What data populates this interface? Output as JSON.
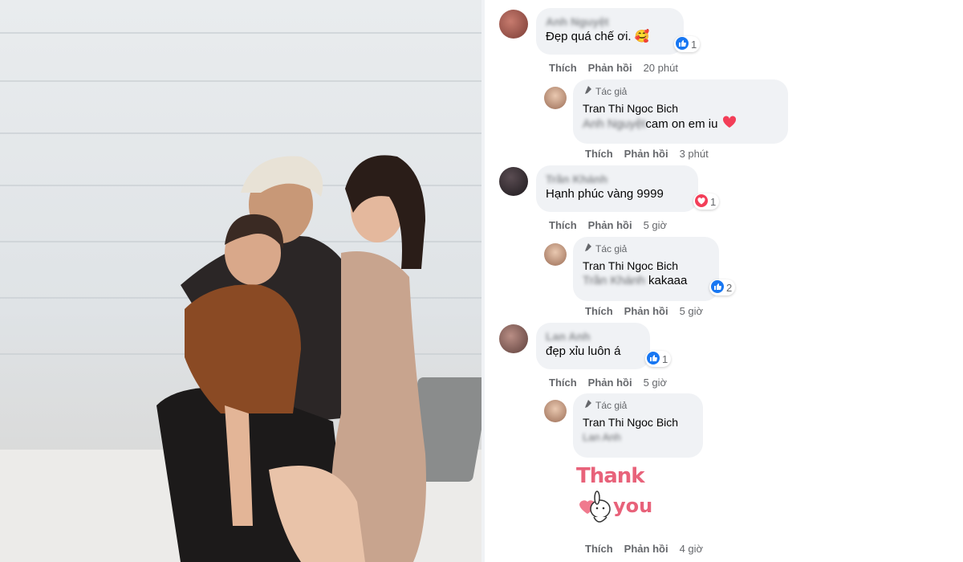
{
  "thread": [
    {
      "commenter_name": "Anh Nguyệt",
      "text": "Đẹp quá chế ơi. 🥰",
      "reaction_count": "1",
      "like_label": "Thích",
      "reply_label": "Phản hồi",
      "time": "20 phút",
      "reply": {
        "author_tag": "Tác giả",
        "author_name": "Tran Thi Ngoc Bich",
        "mention": "Anh Nguyệt",
        "text": " cam on em iu",
        "like_label": "Thích",
        "reply_label": "Phản hồi",
        "time": "3 phút"
      }
    },
    {
      "commenter_name": "Trần Khánh",
      "text": "Hạnh phúc vàng 9999",
      "reaction_count": "1",
      "like_label": "Thích",
      "reply_label": "Phản hồi",
      "time": "5 giờ",
      "reply": {
        "author_tag": "Tác giả",
        "author_name": "Tran Thi Ngoc Bich",
        "mention": "Trần Khánh",
        "text": " kakaaa",
        "reaction_count": "2",
        "like_label": "Thích",
        "reply_label": "Phản hồi",
        "time": "5 giờ"
      }
    },
    {
      "commenter_name": "Lan Anh",
      "text": "đẹp xỉu luôn á",
      "reaction_count": "1",
      "like_label": "Thích",
      "reply_label": "Phản hồi",
      "time": "5 giờ",
      "reply": {
        "author_tag": "Tác giả",
        "author_name": "Tran Thi Ngoc Bich",
        "mention": "Lan Anh",
        "sticker_line1": "Thank",
        "sticker_line2": "you",
        "like_label": "Thích",
        "reply_label": "Phản hồi",
        "time": "4 giờ"
      }
    }
  ],
  "colors": {
    "like_blue": "#1877f2",
    "love_red": "#f33e58",
    "bubble_bg": "#f0f2f5",
    "sticker_pink": "#e8627a"
  }
}
